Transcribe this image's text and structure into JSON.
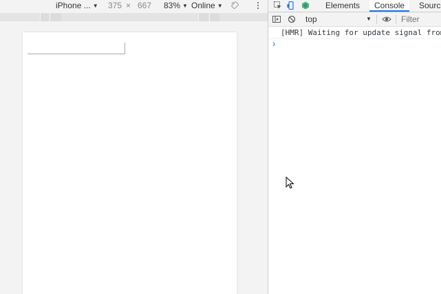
{
  "device_toolbar": {
    "device": "iPhone ...",
    "width": "375",
    "times": "×",
    "height": "667",
    "zoom": "83%",
    "network": "Online"
  },
  "devtools": {
    "tabs": [
      "Elements",
      "Console",
      "Sources"
    ],
    "active_tab": "Console",
    "console_toolbar": {
      "context": "top",
      "filter_placeholder": "Filter"
    },
    "messages": [
      "[HMR] Waiting for update signal from WDS..."
    ],
    "prompt": "›"
  },
  "colors": {
    "accent": "#1a73e8",
    "vue_green": "#42b883"
  },
  "icons": [
    "rotate-icon",
    "more-vert-icon",
    "inspect-element-icon",
    "device-toggle-icon",
    "vue-devtools-icon",
    "console-sidebar-icon",
    "clear-console-icon",
    "eye-icon",
    "mouse-cursor-icon"
  ]
}
